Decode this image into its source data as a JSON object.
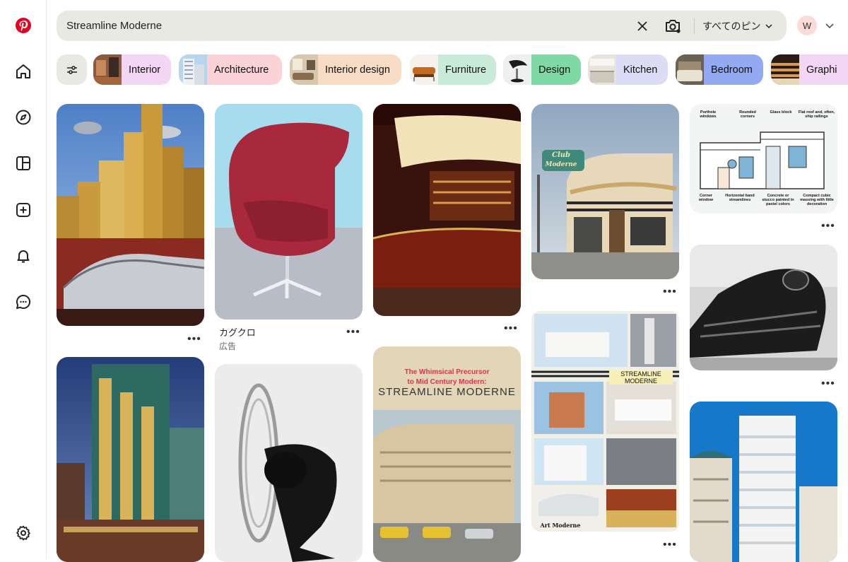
{
  "search": {
    "query": "Streamline Moderne",
    "scope_label": "すべてのピン",
    "avatar_initial": "W"
  },
  "icons": {
    "logo": "pinterest-logo",
    "home": "home-icon",
    "explore": "compass-icon",
    "boards": "board-icon",
    "create": "plus-square-icon",
    "notifications": "bell-icon",
    "messages": "chat-icon",
    "settings": "gear-icon",
    "clear": "close-icon",
    "camera": "camera-search-icon",
    "filter": "sliders-icon"
  },
  "colors": {
    "brand": "#e60023",
    "search_bg": "#e9e9e4",
    "avatar_bg": "#fbdad8"
  },
  "chips": [
    {
      "label": "Interior",
      "bg": "#f3d6f3"
    },
    {
      "label": "Architecture",
      "bg": "#fbd3d6"
    },
    {
      "label": "Interior design",
      "bg": "#f9dcc6"
    },
    {
      "label": "Furniture",
      "bg": "#c9ecd8"
    },
    {
      "label": "Design",
      "bg": "#7fd9a4"
    },
    {
      "label": "Kitchen",
      "bg": "#dcdcf6"
    },
    {
      "label": "Bedroom",
      "bg": "#93a9f2"
    },
    {
      "label": "Graphi",
      "bg": "#f3d6f3"
    }
  ],
  "ad_pin": {
    "title": "カグクロ",
    "sponsored": "広告"
  },
  "pin_texts": {
    "book_line1": "The Whimsical Precursor",
    "book_line2": "to Mid Century Modern:",
    "book_title": "STREAMLINE MODERNE",
    "club_sign_1": "Club",
    "club_sign_2": "Moderne",
    "collage_label": "STREAMLINE MODERNE",
    "collage_footer": "Art Moderne",
    "diagram_top": [
      "Porthole windows",
      "Rounded corners",
      "Glass block",
      "Flat roof and, often, ship railings"
    ],
    "diagram_bottom": [
      "Corner window",
      "Horizontal band streamlines",
      "Concrete or stucco painted in pastel colors",
      "Compact cubic massing with little decoration"
    ]
  },
  "more_label": "•••"
}
